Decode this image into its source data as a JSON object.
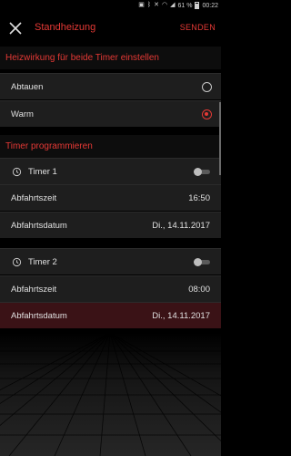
{
  "status_bar": {
    "battery": "61 %",
    "time": "00:22"
  },
  "header": {
    "title": "Standheizung",
    "send_label": "SENDEN"
  },
  "heat_section": {
    "title": "Heizwirkung für beide Timer einstellen",
    "options": [
      {
        "label": "Abtauen",
        "selected": false
      },
      {
        "label": "Warm",
        "selected": true
      }
    ]
  },
  "timer_section": {
    "title": "Timer programmieren",
    "timers": [
      {
        "name": "Timer 1",
        "enabled": false,
        "departure_time_label": "Abfahrtszeit",
        "departure_time": "16:50",
        "departure_date_label": "Abfahrtsdatum",
        "departure_date": "Di., 14.11.2017"
      },
      {
        "name": "Timer 2",
        "enabled": false,
        "departure_time_label": "Abfahrtszeit",
        "departure_time": "08:00",
        "departure_date_label": "Abfahrtsdatum",
        "departure_date": "Di., 14.11.2017"
      }
    ]
  },
  "colors": {
    "accent": "#e53935",
    "row_background": "#1e1e1e",
    "selected_row_background": "#3a1216"
  }
}
